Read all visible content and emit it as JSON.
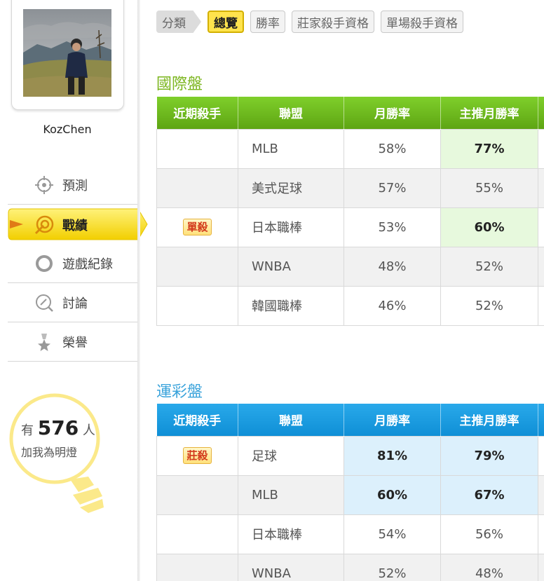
{
  "user": {
    "name": "KozChen"
  },
  "nav": [
    {
      "label": "預測",
      "icon": "crosshair-icon",
      "active": false
    },
    {
      "label": "戰績",
      "icon": "target-icon",
      "active": true
    },
    {
      "label": "遊戲紀錄",
      "icon": "ring-icon",
      "active": false
    },
    {
      "label": "討論",
      "icon": "comment-icon",
      "active": false
    },
    {
      "label": "榮譽",
      "icon": "medal-icon",
      "active": false
    }
  ],
  "fans": {
    "prefix": "有",
    "count": "576",
    "suffix": "人",
    "line2": "加我為明燈"
  },
  "tabs": {
    "category": "分類",
    "items": [
      "總覽",
      "勝率",
      "莊家殺手資格",
      "單場殺手資格"
    ],
    "active": "總覽"
  },
  "sections": {
    "international": {
      "title": "國際盤",
      "headers": [
        "近期殺手",
        "聯盟",
        "月勝率",
        "主推月勝率"
      ],
      "rows": [
        {
          "badge": "",
          "league": "MLB",
          "monthly": "58%",
          "main": "77%"
        },
        {
          "badge": "",
          "league": "美式足球",
          "monthly": "57%",
          "main": "55%"
        },
        {
          "badge": "單殺",
          "league": "日本職棒",
          "monthly": "53%",
          "main": "60%"
        },
        {
          "badge": "",
          "league": "WNBA",
          "monthly": "48%",
          "main": "52%"
        },
        {
          "badge": "",
          "league": "韓國職棒",
          "monthly": "46%",
          "main": "52%"
        }
      ]
    },
    "sports_lottery": {
      "title": "運彩盤",
      "headers": [
        "近期殺手",
        "聯盟",
        "月勝率",
        "主推月勝率"
      ],
      "rows": [
        {
          "badge": "莊殺",
          "league": "足球",
          "monthly": "81%",
          "main": "79%"
        },
        {
          "badge": "",
          "league": "MLB",
          "monthly": "60%",
          "main": "67%"
        },
        {
          "badge": "",
          "league": "日本職棒",
          "monthly": "54%",
          "main": "56%"
        },
        {
          "badge": "",
          "league": "WNBA",
          "monthly": "52%",
          "main": "48%"
        }
      ]
    }
  },
  "colors": {
    "intl_accent": "#6bb51a",
    "sports_accent": "#169be0",
    "active_tab": "#ffe34d",
    "badge_text": "#d2381b"
  }
}
